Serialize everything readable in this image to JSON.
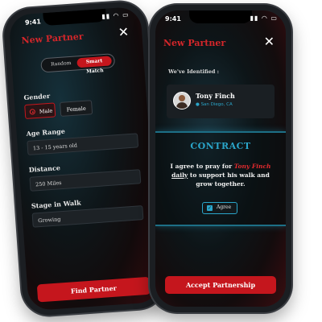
{
  "left_phone": {
    "time": "9:41",
    "title": "New Partner",
    "close_icon": "close-icon",
    "toggle": {
      "option_1": "Random",
      "option_2": "Smart Match"
    },
    "gender_label": "Gender",
    "gender_options": {
      "male": "Male",
      "female": "Female"
    },
    "age_label": "Age Range",
    "age_value": "13 - 15 years old",
    "distance_label": "Distance",
    "distance_value": "250 Miles",
    "stage_label": "Stage in Walk",
    "stage_value": "Growing",
    "find_button": "Find Partner"
  },
  "right_phone": {
    "time": "9:41",
    "title": "New Partner",
    "close_icon": "close-icon",
    "identified_label": "We've Identified :",
    "partner_name": "Tony Finch",
    "partner_location": "San Diego, CA",
    "contract_heading": "CONTRACT",
    "contract_text_1": "I agree to pray for",
    "contract_name": "Tony Finch",
    "contract_daily": "daily",
    "contract_text_2": "to support his walk and grow together.",
    "agree_label": "Agree",
    "accept_button": "Accept Partnership"
  },
  "colors": {
    "accent": "#c5161d",
    "title": "#d3262a",
    "highlight": "#e02a2e",
    "location": "#2aa5c9"
  }
}
